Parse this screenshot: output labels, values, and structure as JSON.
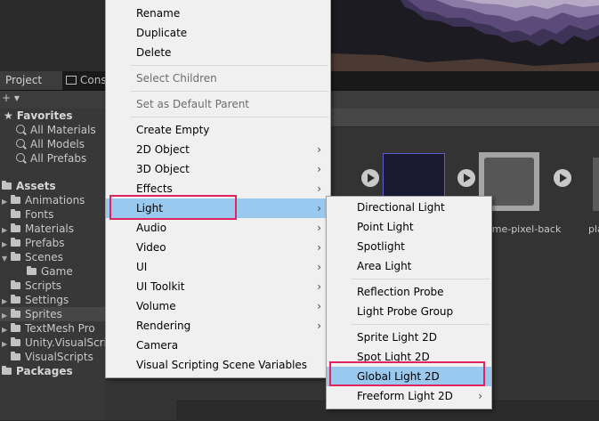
{
  "tabs": {
    "project": "Project",
    "console": "Cons"
  },
  "sidebar": {
    "favorites": {
      "label": "Favorites",
      "items": [
        "All Materials",
        "All Models",
        "All Prefabs"
      ]
    },
    "assets": {
      "label": "Assets",
      "items": [
        "Animations",
        "Fonts",
        "Materials",
        "Prefabs",
        "Scenes",
        "Game",
        "Scripts",
        "Settings",
        "Sprites",
        "TextMesh Pro",
        "Unity.VisualScri",
        "VisualScripts"
      ]
    },
    "packages": "Packages"
  },
  "assets_pane": {
    "labels": [
      "ame-pixel-back",
      "pla"
    ]
  },
  "context_menu": {
    "items": [
      "Rename",
      "Duplicate",
      "Delete",
      "Select Children",
      "Set as Default Parent",
      "Create Empty",
      "2D Object",
      "3D Object",
      "Effects",
      "Light",
      "Audio",
      "Video",
      "UI",
      "UI Toolkit",
      "Volume",
      "Rendering",
      "Camera",
      "Visual Scripting Scene Variables"
    ]
  },
  "light_submenu": {
    "items": [
      "Directional Light",
      "Point Light",
      "Spotlight",
      "Area Light",
      "Reflection Probe",
      "Light Probe Group",
      "Sprite Light 2D",
      "Spot Light 2D",
      "Global Light 2D",
      "Freeform Light 2D"
    ]
  },
  "colors": {
    "menu_highlight": "#99c9ef",
    "callout": "#e0245e",
    "menu_bg": "#f0f0f0",
    "editor_bg": "#282828"
  },
  "icons": [
    "star-icon",
    "search-icon",
    "folder-icon",
    "play-icon",
    "submenu-arrow-icon",
    "console-icon"
  ]
}
